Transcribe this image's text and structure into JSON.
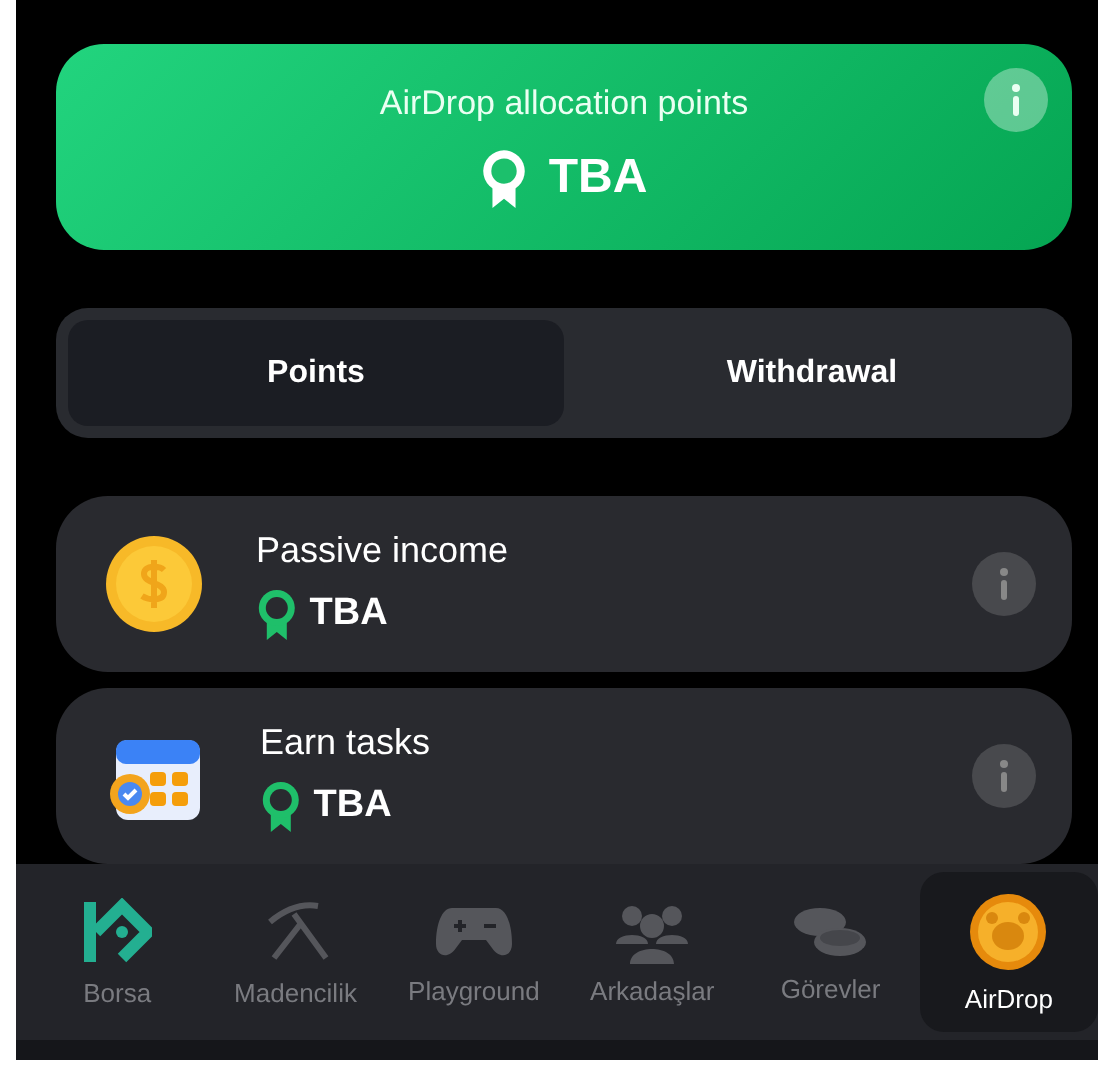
{
  "hero": {
    "title": "AirDrop allocation points",
    "value": "TBA"
  },
  "tabs": [
    {
      "label": "Points",
      "selected": true
    },
    {
      "label": "Withdrawal",
      "selected": false
    }
  ],
  "rows": [
    {
      "kind": "coin",
      "title": "Passive income",
      "value": "TBA"
    },
    {
      "kind": "calendar",
      "title": "Earn tasks",
      "value": "TBA"
    }
  ],
  "nav": [
    {
      "kind": "logo",
      "label": "Borsa",
      "selected": false
    },
    {
      "kind": "pickaxe",
      "label": "Madencilik",
      "selected": false
    },
    {
      "kind": "gamepad",
      "label": "Playground",
      "selected": false
    },
    {
      "kind": "friends",
      "label": "Arkadaşlar",
      "selected": false
    },
    {
      "kind": "coins",
      "label": "Görevler",
      "selected": false
    },
    {
      "kind": "hamster",
      "label": "AirDrop",
      "selected": true
    }
  ]
}
